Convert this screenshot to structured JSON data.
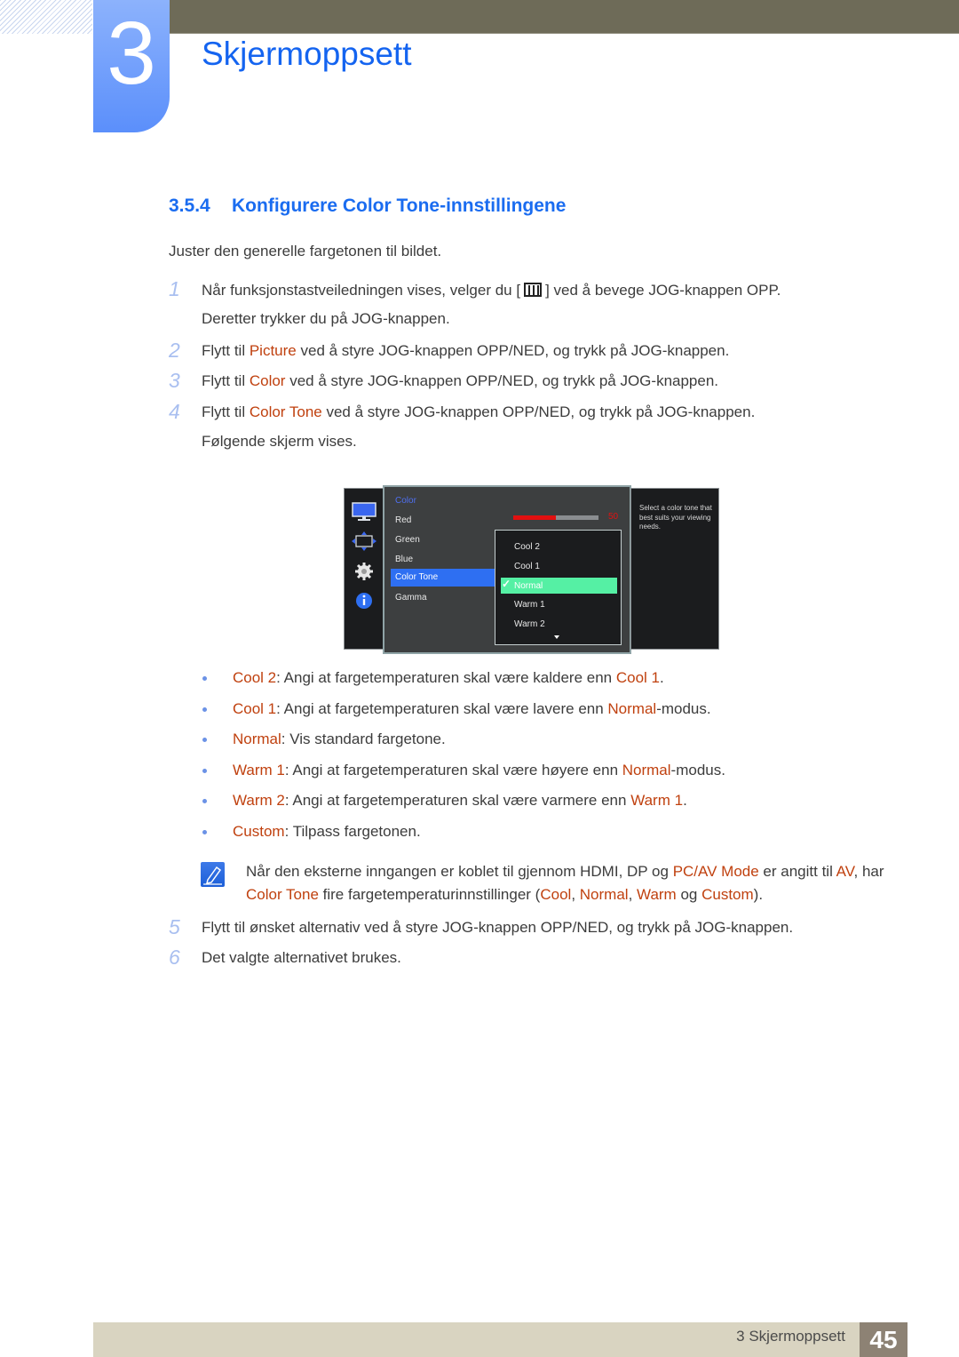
{
  "header": {
    "chapter_number": "3",
    "chapter_title": "Skjermoppsett"
  },
  "section": {
    "number": "3.5.4",
    "title": "Konfigurere Color Tone-innstillingene"
  },
  "intro": "Juster den generelle fargetonen til bildet.",
  "steps": [
    {
      "n": "1",
      "line1_a": "Når funksjonstastveiledningen vises, velger du [",
      "icon": "menu-icon",
      "line1_b": "] ved å bevege JOG-knappen OPP.",
      "line2": "Deretter trykker du på JOG-knappen."
    },
    {
      "n": "2",
      "pre": "Flytt til ",
      "hl": "Picture",
      "post": " ved å styre JOG-knappen OPP/NED, og trykk på JOG-knappen."
    },
    {
      "n": "3",
      "pre": "Flytt til ",
      "hl": "Color",
      "post": " ved å styre JOG-knappen OPP/NED, og trykk på JOG-knappen."
    },
    {
      "n": "4",
      "pre": "Flytt til ",
      "hl": "Color Tone",
      "post": " ved å styre JOG-knappen OPP/NED, og trykk på JOG-knappen.",
      "line2": "Følgende skjerm vises."
    },
    {
      "n": "5",
      "text": "Flytt til ønsket alternativ ved å styre JOG-knappen OPP/NED, og trykk på JOG-knappen."
    },
    {
      "n": "6",
      "text": "Det valgte alternativet brukes."
    }
  ],
  "osd": {
    "side_icons": [
      "monitor-icon",
      "resize-icon",
      "gear-icon",
      "info-icon"
    ],
    "menu_title": "Color",
    "menu_items": [
      "Red",
      "Green",
      "Blue",
      "Color Tone",
      "Gamma"
    ],
    "selected_item": "Color Tone",
    "red_value": "50",
    "red_fraction": 0.5,
    "dropdown_options": [
      "Cool 2",
      "Cool 1",
      "Normal",
      "Warm 1",
      "Warm 2"
    ],
    "dropdown_selected": "Normal",
    "help_text": "Select a color tone that best suits your viewing needs.",
    "colors": {
      "accent_blue": "#2e6ff2",
      "selected_green": "#55f0a4",
      "red": "#e21010"
    }
  },
  "bullets": [
    {
      "term": "Cool 2",
      "desc": ": Angi at fargetemperaturen skal være kaldere enn ",
      "ref": "Cool 1",
      "end": "."
    },
    {
      "term": "Cool 1",
      "desc": ": Angi at fargetemperaturen skal være lavere enn ",
      "ref": "Normal",
      "end": "-modus."
    },
    {
      "term": "Normal",
      "desc": ": Vis standard fargetone.",
      "ref": "",
      "end": ""
    },
    {
      "term": "Warm 1",
      "desc": ": Angi at fargetemperaturen skal være høyere enn ",
      "ref": "Normal",
      "end": "-modus."
    },
    {
      "term": "Warm 2",
      "desc": ": Angi at fargetemperaturen skal være varmere enn ",
      "ref": "Warm 1",
      "end": "."
    },
    {
      "term": "Custom",
      "desc": ": Tilpass fargetonen.",
      "ref": "",
      "end": ""
    }
  ],
  "note": {
    "l1_a": "Når den eksterne inngangen er koblet til gjennom HDMI, DP og ",
    "l1_hl1": "PC/AV Mode",
    "l1_b": " er angitt til ",
    "l1_hl2": "AV",
    "l1_c": ", har",
    "l2_hl1": "Color Tone",
    "l2_a": " fire fargetemperaturinnstillinger (",
    "l2_hl2": "Cool",
    "l2_sep1": ", ",
    "l2_hl3": "Normal",
    "l2_sep2": ", ",
    "l2_hl4": "Warm",
    "l2_b": " og ",
    "l2_hl5": "Custom",
    "l2_c": ")."
  },
  "footer": {
    "label": "3 Skjermoppsett",
    "page": "45"
  },
  "colors": {
    "heading_blue": "#1464f0",
    "highlight_orange": "#c0410f",
    "step_number": "#a9bff0",
    "footer_bg": "#d9d4c1",
    "page_box": "#8d8274"
  }
}
